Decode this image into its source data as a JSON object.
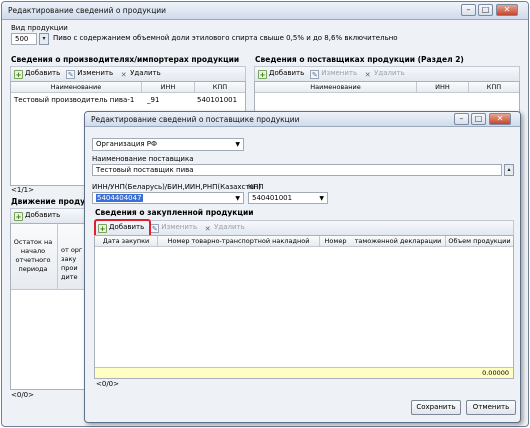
{
  "main": {
    "title": "Редактирование сведений о продукции",
    "product_type_label": "Вид продукции",
    "product_code": "500",
    "product_desc": "Пиво с содержанием объемной доли этилового спирта свыше 0,5% и до 8,6% включительно",
    "producers_header": "Сведения о производителях/импортерах продукции",
    "suppliers_header": "Сведения о поставщиках продукции (Раздел 2)",
    "toolbar": {
      "add": "Добавить",
      "edit": "Изменить",
      "delete": "Удалить"
    },
    "producers_columns": [
      "Наименование",
      "ИНН",
      "КПП"
    ],
    "producers_rows": [
      {
        "name": "Тестовый производитель пива-1",
        "inn": "_91",
        "kpp": "540101001"
      }
    ],
    "suppliers_columns": [
      "Наименование",
      "ИНН",
      "КПП"
    ],
    "counter1": "<1/1>",
    "movement_header": "Движение продук",
    "movement_col1": "Остаток на начало отчетного периода",
    "movement_col2": "от орг заку прои дите",
    "counter2": "<0/0>"
  },
  "dialog": {
    "title": "Редактирование сведений о поставщике продукции",
    "org_type": "Организация РФ",
    "supplier_name_label": "Наименование поставщика",
    "supplier_name": "Тестовый поставщик пива",
    "inn_label": "ИНН/УНП(Беларусь)/БИН,ИИН,РНП(Казахстан)",
    "inn_value": "5404404047",
    "kpp_label": "КПП",
    "kpp_value": "540401001",
    "purchased_header": "Сведения о закупленной продукции",
    "toolbar": {
      "add": "Добавить",
      "edit": "Изменить",
      "delete": "Удалить"
    },
    "columns": [
      "Дата закупки",
      "Номер товарно-транспортной накладной",
      "Номер",
      "таможенной декларации",
      "Объем продукции"
    ],
    "total": "0.00000",
    "counter": "<0/0>",
    "save": "Сохранить",
    "cancel": "Отменить"
  }
}
